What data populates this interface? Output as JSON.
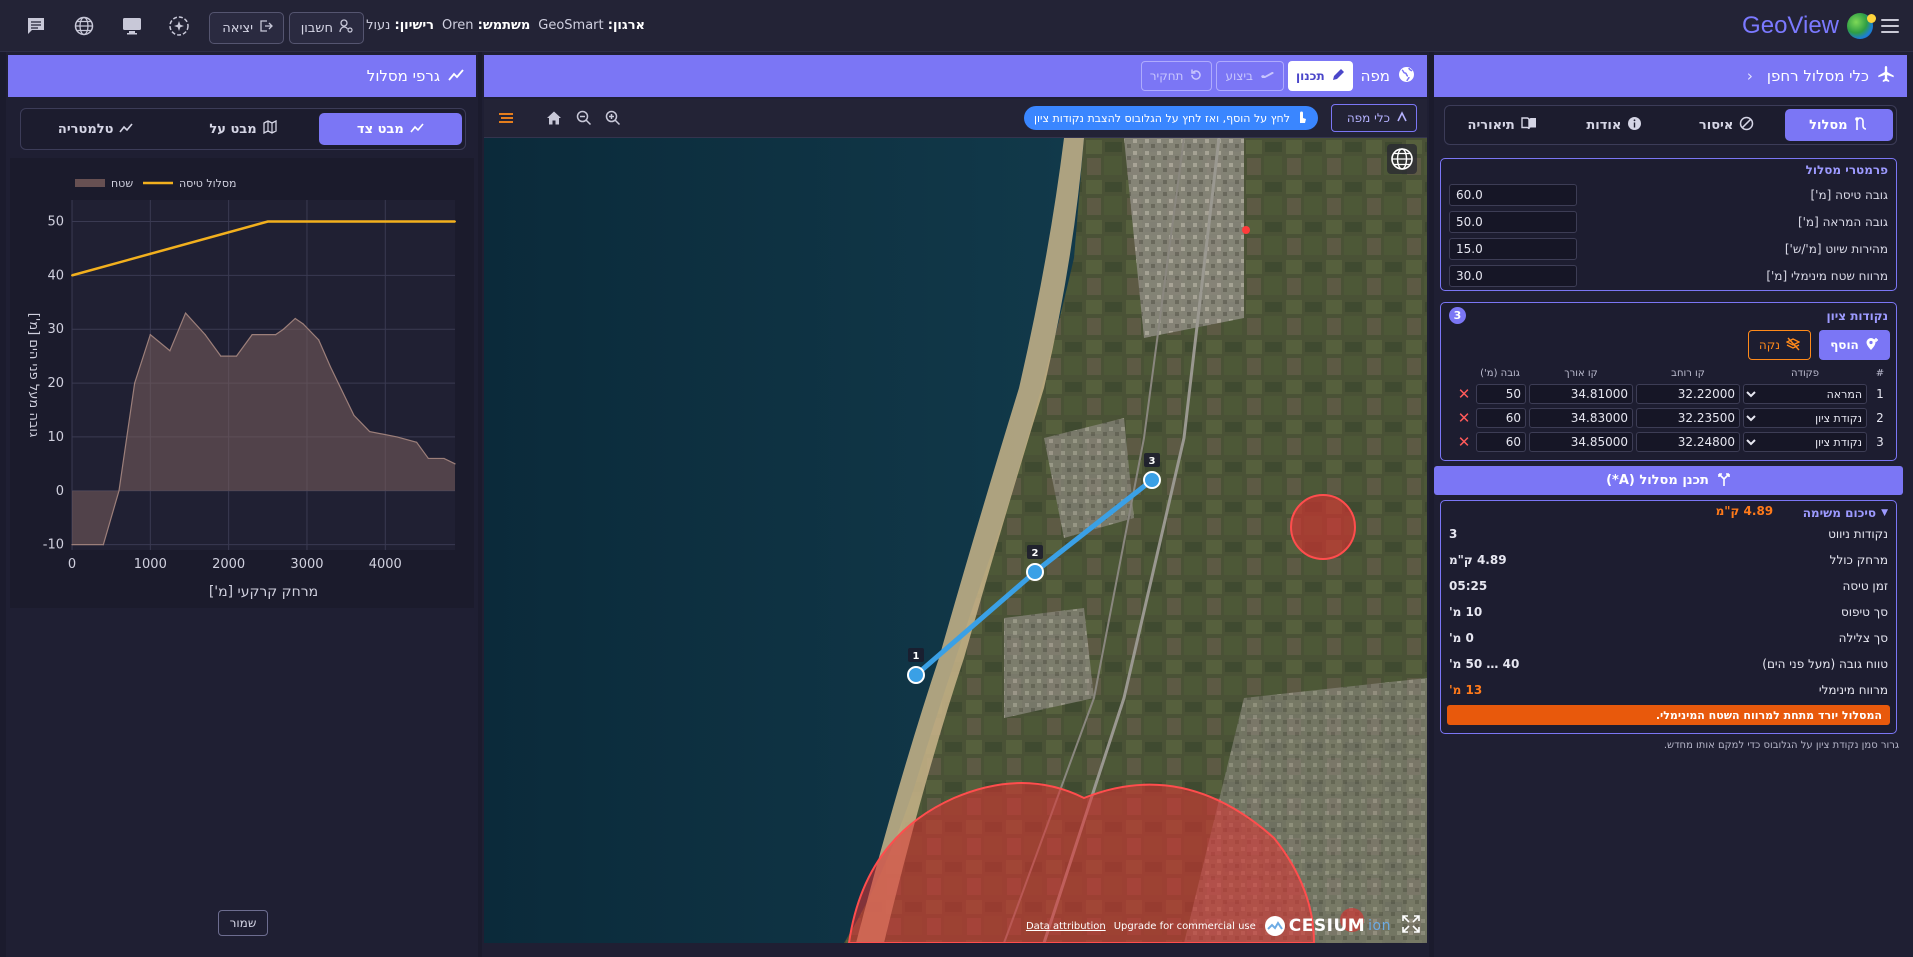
{
  "topbar": {
    "brand": "GeoView",
    "org_label": "ארגון:",
    "org_value": "GeoSmart",
    "user_label": "משתמש:",
    "user_value": "Oren",
    "license_label": "רישיון:",
    "license_value": "נעול",
    "account_button": "חשבון",
    "logout_button": "יציאה"
  },
  "right_panel": {
    "title": "כלי מסלול רחפן",
    "tabs": [
      {
        "label": "מסלול",
        "active": true
      },
      {
        "label": "איסור",
        "active": false
      },
      {
        "label": "אודות",
        "active": false
      },
      {
        "label": "תיאוריה",
        "active": false
      }
    ],
    "params": {
      "title": "פרמטרי מסלול",
      "fields": [
        {
          "label": "גובה טיסה [מ']",
          "value": "60.0"
        },
        {
          "label": "גובה המראה [מ']",
          "value": "50.0"
        },
        {
          "label": "מהירות שיוט [מ'/ש']",
          "value": "15.0"
        },
        {
          "label": "מרווח שטח מינימלי [מ']",
          "value": "30.0"
        }
      ]
    },
    "waypoints": {
      "title": "נקודות ציון",
      "count": "3",
      "add_button": "הוסף",
      "clear_button": "נקה",
      "headers": {
        "num": "#",
        "action": "פקודה",
        "lat": "קו רוחב",
        "lon": "קו אורך",
        "alt": "גובה (מ')"
      },
      "rows": [
        {
          "num": "1",
          "action": "המראה",
          "lat": "32.22000",
          "lon": "34.81000",
          "alt": "50"
        },
        {
          "num": "2",
          "action": "נקודת ציון",
          "lat": "32.23500",
          "lon": "34.83000",
          "alt": "60"
        },
        {
          "num": "3",
          "action": "נקודת ציון",
          "lat": "32.24800",
          "lon": "34.85000",
          "alt": "60"
        }
      ]
    },
    "plan_button": "תכנן מסלול (A*)",
    "summary": {
      "title": "סיכום משימה",
      "total_badge": "4.89 ק\"מ",
      "rows": [
        {
          "label": "נקודות ניווט",
          "value": "3",
          "warn": false
        },
        {
          "label": "מרחק כולל",
          "value": "4.89 ק\"מ",
          "warn": false
        },
        {
          "label": "זמן טיסה",
          "value": "05:25",
          "warn": false
        },
        {
          "label": "סך טיפוס",
          "value": "10 מ'",
          "warn": false
        },
        {
          "label": "סך צלילה",
          "value": "0 מ'",
          "warn": false
        },
        {
          "label": "טווח גובה (מעל פני הים)",
          "value": "40 … 50 מ'",
          "warn": false
        },
        {
          "label": "מרווח מינימלי",
          "value": "13 מ'",
          "warn": true
        }
      ],
      "alert": "המסלול יורד מתחת למרווח השטח המינימלי."
    },
    "hint": "גרור סמן נקודת ציון על הגלובוס כדי למקם אותו מחדש."
  },
  "map_panel": {
    "title": "מפה",
    "mode_plan": "תכנון",
    "mode_exec": "ביצוע",
    "mode_review": "תחקיר",
    "tools_button": "כלי מפה",
    "instruction": "לחץ על הוסף, ואז לחץ על הגלובוס להצבת נקודות ציון",
    "attribution": "Data attribution",
    "upgrade": "Upgrade for commercial use",
    "cesium": "CESIUM",
    "cesium_ion": "ion",
    "markers": [
      "1",
      "2",
      "3"
    ]
  },
  "left_panel": {
    "title": "גרפי מסלול",
    "tabs": [
      {
        "label": "מבט צד",
        "active": true
      },
      {
        "label": "מבט על",
        "active": false
      },
      {
        "label": "טלמטריה",
        "active": false
      }
    ],
    "save_button": "שמור"
  },
  "chart_data": {
    "type": "area",
    "xlabel": "מרחק קרקעי [מ']",
    "ylabel": "גובה מעל פני הים [מ']",
    "xlim": [
      0,
      4890
    ],
    "ylim": [
      -11,
      54
    ],
    "xticks": [
      "0",
      "1000",
      "2000",
      "3000",
      "4000"
    ],
    "yticks": [
      "-10",
      "0",
      "10",
      "20",
      "30",
      "40",
      "50"
    ],
    "grid": true,
    "legend_position": "top-left",
    "series": [
      {
        "name": "מסלול טיסה",
        "color": "#f2b01e",
        "x": [
          0,
          2500,
          4890
        ],
        "y": [
          40,
          50,
          50
        ]
      },
      {
        "name": "שטח",
        "color": "#7a5e5c",
        "x": [
          0,
          400,
          600,
          800,
          1000,
          1250,
          1450,
          1700,
          1900,
          2100,
          2300,
          2600,
          2700,
          2850,
          2950,
          3150,
          3300,
          3600,
          3800,
          4150,
          4400,
          4550,
          4750,
          4890
        ],
        "y": [
          -10,
          -10,
          0,
          20,
          29,
          26,
          33,
          29,
          25,
          25,
          29,
          29,
          30,
          32,
          31,
          28,
          23,
          14,
          11,
          10,
          9,
          6,
          6,
          5
        ]
      }
    ]
  },
  "colors": {
    "accent": "#7b76f5",
    "warn": "#ff7a1a",
    "alert_bg": "#e8590c",
    "route": "#3aa0e6",
    "no_fly": "#e03131"
  }
}
